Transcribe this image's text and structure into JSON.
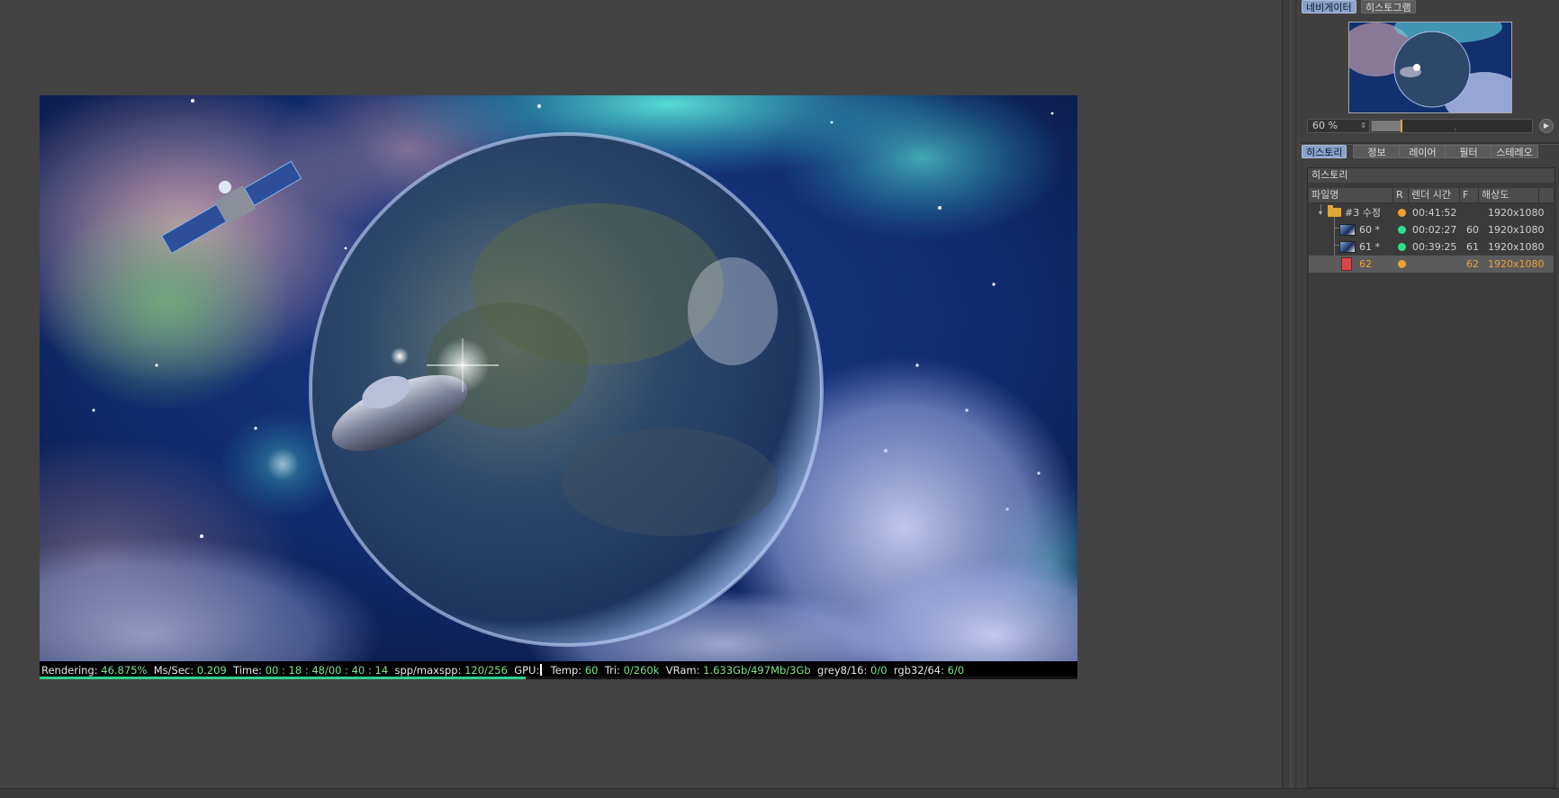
{
  "status_bar": {
    "rendering_label": "Rendering:",
    "rendering_value": "46.875%",
    "ms_label": "Ms/Sec:",
    "ms_value": "0.209",
    "time_label": "Time:",
    "time_value": "00 : 18 : 48/00 : 40 : 14",
    "spp_label": "spp/maxspp:",
    "spp_value": "120/256",
    "gpu_label": "GPU:",
    "temp_label": "Temp:",
    "temp_value": "60",
    "tri_label": "Tri:",
    "tri_value": "0/260k",
    "vram_label": "VRam:",
    "vram_value": "1.633Gb/497Mb/3Gb",
    "grey_label": "grey8/16:",
    "grey_value": "0/0",
    "rgb_label": "rgb32/64:",
    "rgb_value": "6/0",
    "progress_fraction": 0.46875
  },
  "navigator": {
    "tabs": [
      "네비게이터",
      "히스토그램"
    ],
    "active_tab": 0,
    "zoom": "60 %",
    "zoom_fraction": 0.18
  },
  "history_panel": {
    "tabs": [
      "히스토리",
      "정보",
      "레이어",
      "필터",
      "스테레오"
    ],
    "active_tab": 0,
    "title": "히스토리",
    "columns": [
      "파일명",
      "R",
      "렌더 시간",
      "F",
      "해상도"
    ],
    "rows": [
      {
        "name": "#3 수정",
        "status_color": "#f0a030",
        "time": "00:41:52",
        "frame": "",
        "resolution": "1920x1080",
        "kind": "folder"
      },
      {
        "name": "60 *",
        "status_color": "#2ee08a",
        "time": "00:02:27",
        "frame": "60",
        "resolution": "1920x1080",
        "kind": "image"
      },
      {
        "name": "61 *",
        "status_color": "#2ee08a",
        "time": "00:39:25",
        "frame": "61",
        "resolution": "1920x1080",
        "kind": "image"
      },
      {
        "name": "62",
        "status_color": "#f0a030",
        "time": "",
        "frame": "62",
        "resolution": "1920x1080",
        "kind": "rendering"
      }
    ]
  },
  "colors": {
    "accent_orange": "#e8a23a",
    "progress_green": "#2fd08a",
    "status_value_green": "#7fe38f",
    "active_tab_blue": "#8aa2c8"
  }
}
